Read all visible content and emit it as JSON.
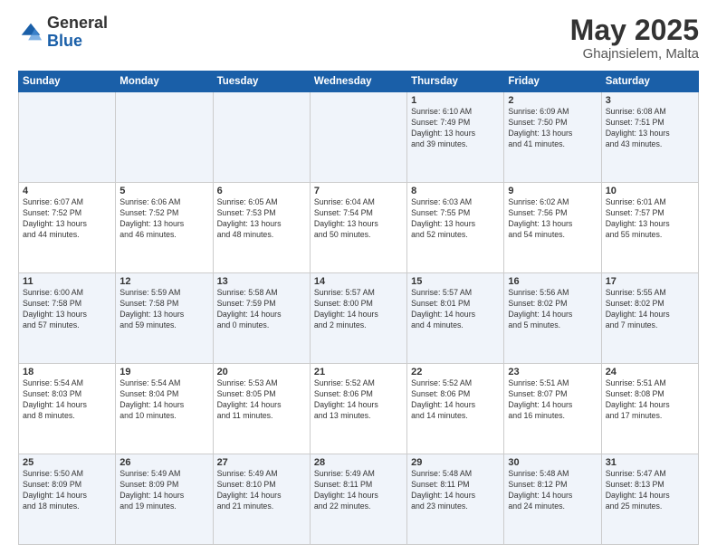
{
  "header": {
    "logo_general": "General",
    "logo_blue": "Blue",
    "month_title": "May 2025",
    "location": "Ghajnsielem, Malta"
  },
  "days_of_week": [
    "Sunday",
    "Monday",
    "Tuesday",
    "Wednesday",
    "Thursday",
    "Friday",
    "Saturday"
  ],
  "weeks": [
    {
      "cells": [
        {
          "day": "",
          "content": ""
        },
        {
          "day": "",
          "content": ""
        },
        {
          "day": "",
          "content": ""
        },
        {
          "day": "",
          "content": ""
        },
        {
          "day": "1",
          "content": "Sunrise: 6:10 AM\nSunset: 7:49 PM\nDaylight: 13 hours\nand 39 minutes."
        },
        {
          "day": "2",
          "content": "Sunrise: 6:09 AM\nSunset: 7:50 PM\nDaylight: 13 hours\nand 41 minutes."
        },
        {
          "day": "3",
          "content": "Sunrise: 6:08 AM\nSunset: 7:51 PM\nDaylight: 13 hours\nand 43 minutes."
        }
      ]
    },
    {
      "cells": [
        {
          "day": "4",
          "content": "Sunrise: 6:07 AM\nSunset: 7:52 PM\nDaylight: 13 hours\nand 44 minutes."
        },
        {
          "day": "5",
          "content": "Sunrise: 6:06 AM\nSunset: 7:52 PM\nDaylight: 13 hours\nand 46 minutes."
        },
        {
          "day": "6",
          "content": "Sunrise: 6:05 AM\nSunset: 7:53 PM\nDaylight: 13 hours\nand 48 minutes."
        },
        {
          "day": "7",
          "content": "Sunrise: 6:04 AM\nSunset: 7:54 PM\nDaylight: 13 hours\nand 50 minutes."
        },
        {
          "day": "8",
          "content": "Sunrise: 6:03 AM\nSunset: 7:55 PM\nDaylight: 13 hours\nand 52 minutes."
        },
        {
          "day": "9",
          "content": "Sunrise: 6:02 AM\nSunset: 7:56 PM\nDaylight: 13 hours\nand 54 minutes."
        },
        {
          "day": "10",
          "content": "Sunrise: 6:01 AM\nSunset: 7:57 PM\nDaylight: 13 hours\nand 55 minutes."
        }
      ]
    },
    {
      "cells": [
        {
          "day": "11",
          "content": "Sunrise: 6:00 AM\nSunset: 7:58 PM\nDaylight: 13 hours\nand 57 minutes."
        },
        {
          "day": "12",
          "content": "Sunrise: 5:59 AM\nSunset: 7:58 PM\nDaylight: 13 hours\nand 59 minutes."
        },
        {
          "day": "13",
          "content": "Sunrise: 5:58 AM\nSunset: 7:59 PM\nDaylight: 14 hours\nand 0 minutes."
        },
        {
          "day": "14",
          "content": "Sunrise: 5:57 AM\nSunset: 8:00 PM\nDaylight: 14 hours\nand 2 minutes."
        },
        {
          "day": "15",
          "content": "Sunrise: 5:57 AM\nSunset: 8:01 PM\nDaylight: 14 hours\nand 4 minutes."
        },
        {
          "day": "16",
          "content": "Sunrise: 5:56 AM\nSunset: 8:02 PM\nDaylight: 14 hours\nand 5 minutes."
        },
        {
          "day": "17",
          "content": "Sunrise: 5:55 AM\nSunset: 8:02 PM\nDaylight: 14 hours\nand 7 minutes."
        }
      ]
    },
    {
      "cells": [
        {
          "day": "18",
          "content": "Sunrise: 5:54 AM\nSunset: 8:03 PM\nDaylight: 14 hours\nand 8 minutes."
        },
        {
          "day": "19",
          "content": "Sunrise: 5:54 AM\nSunset: 8:04 PM\nDaylight: 14 hours\nand 10 minutes."
        },
        {
          "day": "20",
          "content": "Sunrise: 5:53 AM\nSunset: 8:05 PM\nDaylight: 14 hours\nand 11 minutes."
        },
        {
          "day": "21",
          "content": "Sunrise: 5:52 AM\nSunset: 8:06 PM\nDaylight: 14 hours\nand 13 minutes."
        },
        {
          "day": "22",
          "content": "Sunrise: 5:52 AM\nSunset: 8:06 PM\nDaylight: 14 hours\nand 14 minutes."
        },
        {
          "day": "23",
          "content": "Sunrise: 5:51 AM\nSunset: 8:07 PM\nDaylight: 14 hours\nand 16 minutes."
        },
        {
          "day": "24",
          "content": "Sunrise: 5:51 AM\nSunset: 8:08 PM\nDaylight: 14 hours\nand 17 minutes."
        }
      ]
    },
    {
      "cells": [
        {
          "day": "25",
          "content": "Sunrise: 5:50 AM\nSunset: 8:09 PM\nDaylight: 14 hours\nand 18 minutes."
        },
        {
          "day": "26",
          "content": "Sunrise: 5:49 AM\nSunset: 8:09 PM\nDaylight: 14 hours\nand 19 minutes."
        },
        {
          "day": "27",
          "content": "Sunrise: 5:49 AM\nSunset: 8:10 PM\nDaylight: 14 hours\nand 21 minutes."
        },
        {
          "day": "28",
          "content": "Sunrise: 5:49 AM\nSunset: 8:11 PM\nDaylight: 14 hours\nand 22 minutes."
        },
        {
          "day": "29",
          "content": "Sunrise: 5:48 AM\nSunset: 8:11 PM\nDaylight: 14 hours\nand 23 minutes."
        },
        {
          "day": "30",
          "content": "Sunrise: 5:48 AM\nSunset: 8:12 PM\nDaylight: 14 hours\nand 24 minutes."
        },
        {
          "day": "31",
          "content": "Sunrise: 5:47 AM\nSunset: 8:13 PM\nDaylight: 14 hours\nand 25 minutes."
        }
      ]
    }
  ]
}
